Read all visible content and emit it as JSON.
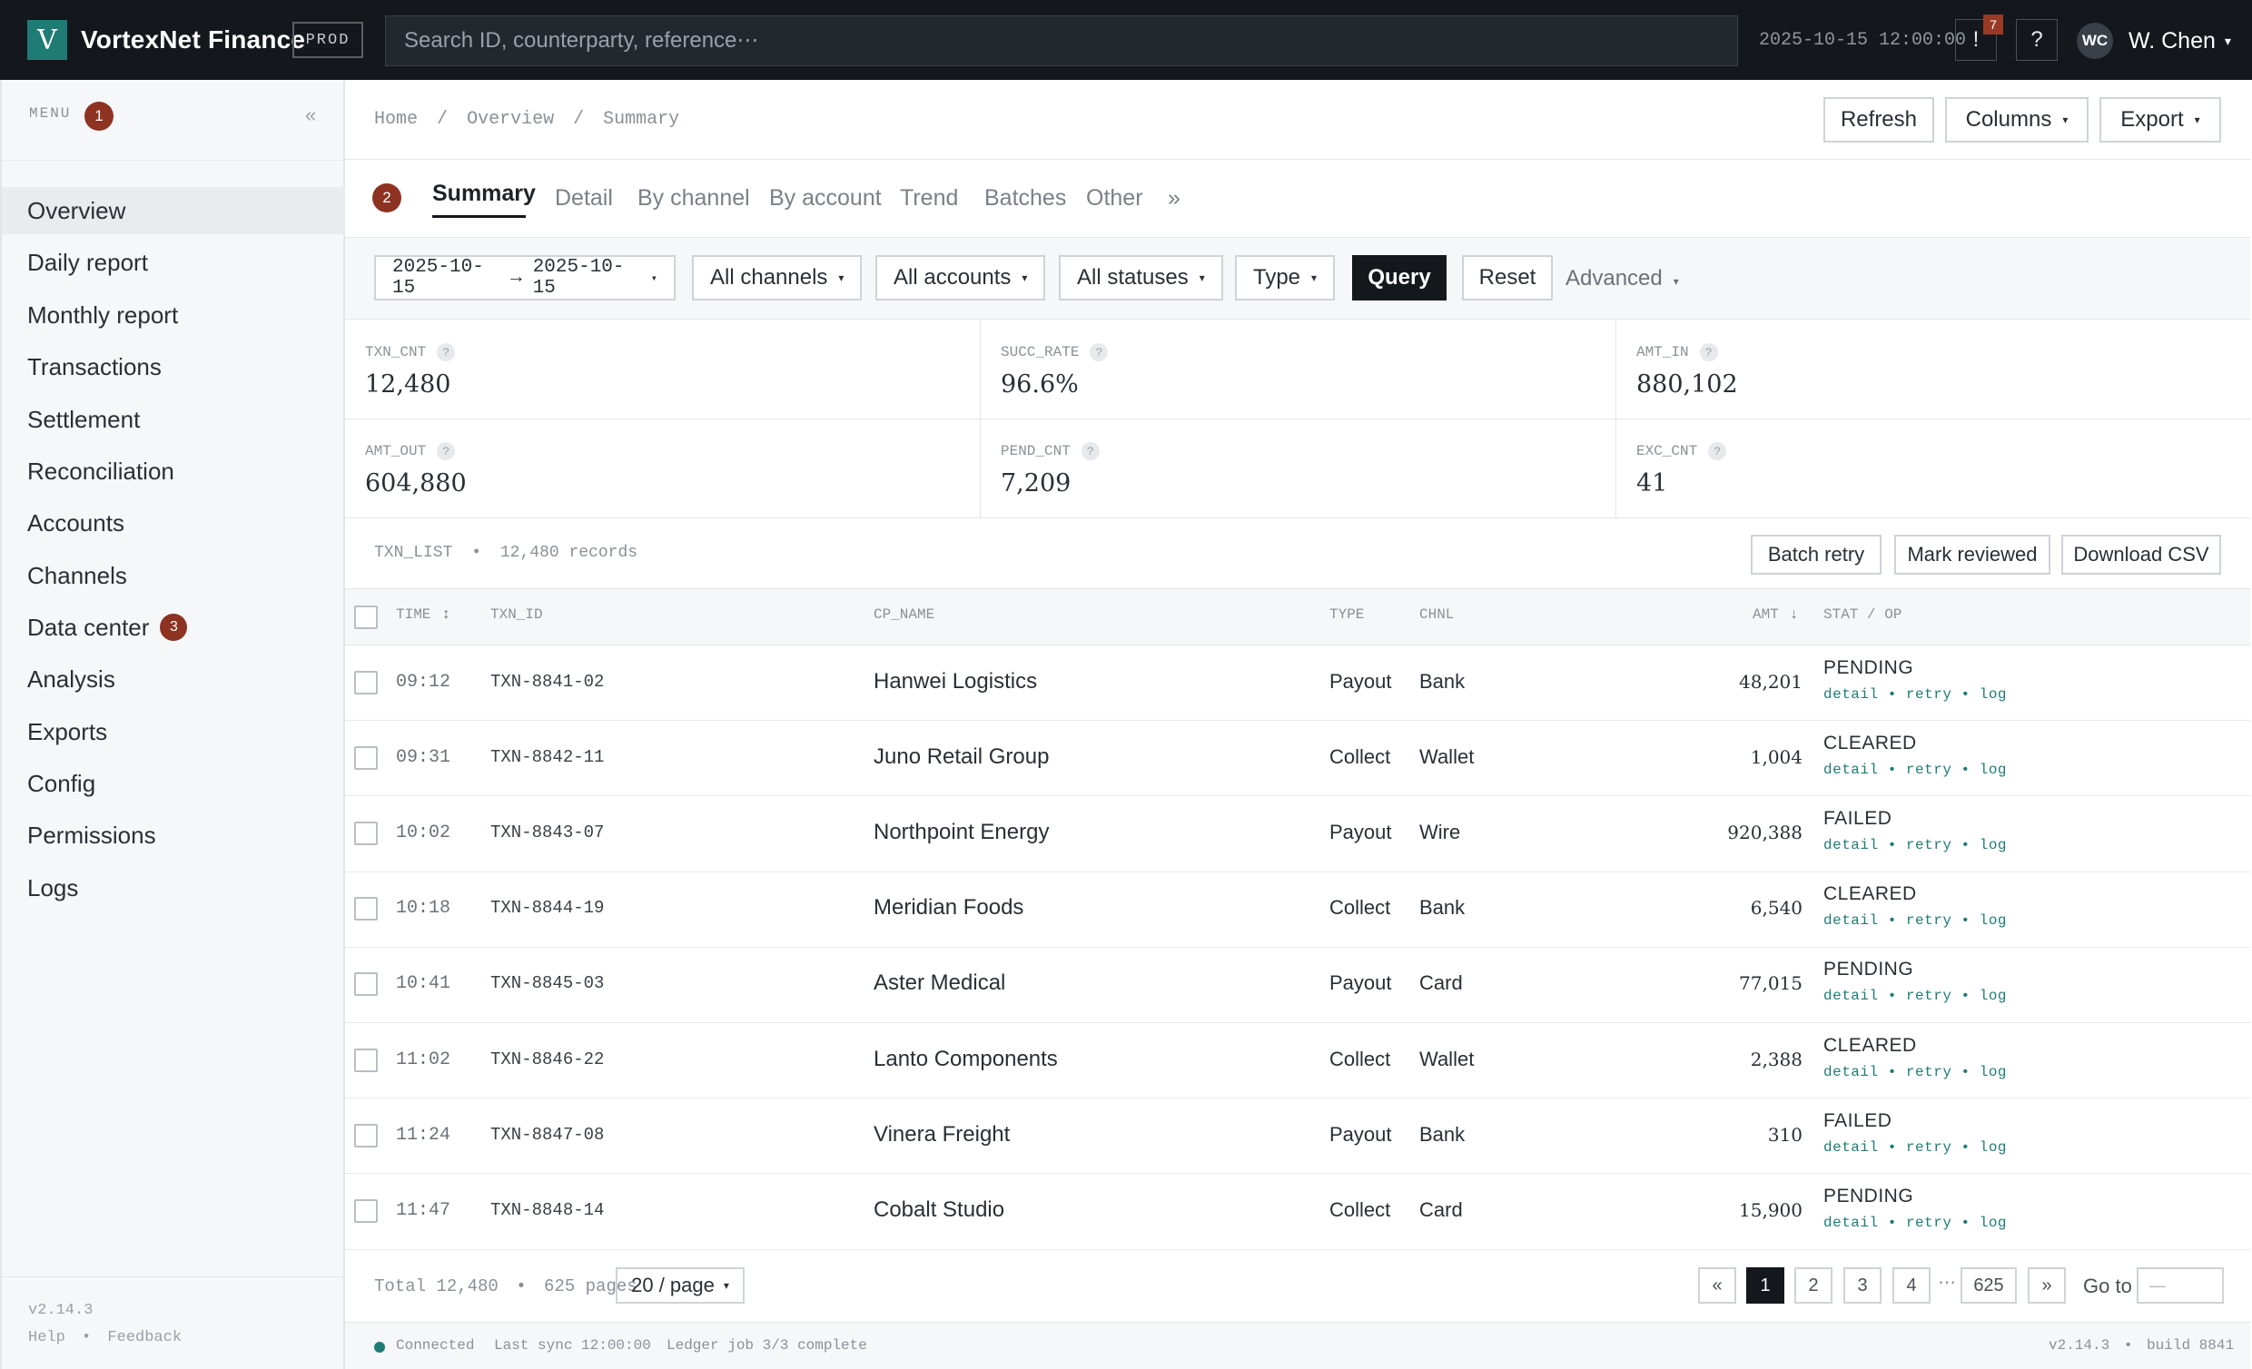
{
  "topbar": {
    "logo_letter": "V",
    "brand": "VortexNet Finance",
    "env": "PROD",
    "search_placeholder": "Search ID, counterparty, reference⋯",
    "datetime": "2025-10-15 12:00:00",
    "alert_label": "!",
    "alert_count": "7",
    "help_label": "?",
    "avatar_initials": "WC",
    "user_name": "W. Chen",
    "caret": "▾"
  },
  "sidebar": {
    "menu_label": "MENU",
    "menu_badge": "1",
    "collapse": "«",
    "items": [
      {
        "label": "Overview"
      },
      {
        "label": "Daily report"
      },
      {
        "label": "Monthly report"
      },
      {
        "label": "Transactions"
      },
      {
        "label": "Settlement"
      },
      {
        "label": "Reconciliation"
      },
      {
        "label": "Accounts"
      },
      {
        "label": "Channels"
      },
      {
        "label": "Data center",
        "badge": "3"
      },
      {
        "label": "Analysis"
      },
      {
        "label": "Exports"
      },
      {
        "label": "Config"
      },
      {
        "label": "Permissions"
      },
      {
        "label": "Logs"
      }
    ],
    "version": "v2.14.3",
    "help": "Help",
    "bullet": "•",
    "feedback": "Feedback"
  },
  "header": {
    "breadcrumb": [
      "Home",
      "Overview",
      "Summary"
    ],
    "breadcrumb_sep": "/",
    "refresh": "Refresh",
    "columns": "Columns",
    "export": "Export"
  },
  "tabs": {
    "badge": "2",
    "items": [
      "Summary",
      "Detail",
      "By channel",
      "By account",
      "Trend",
      "Batches",
      "Other"
    ],
    "more": "»"
  },
  "filters": {
    "date_from": "2025-10-15",
    "arrow": "→",
    "date_to": "2025-10-15",
    "channels": "All channels",
    "accounts": "All accounts",
    "statuses": "All statuses",
    "type": "Type",
    "query": "Query",
    "reset": "Reset",
    "advanced": "Advanced"
  },
  "stats": [
    {
      "label": "TXN_CNT",
      "value": "12,480"
    },
    {
      "label": "SUCC_RATE",
      "value": "96.6%"
    },
    {
      "label": "AMT_IN",
      "value": "880,102"
    },
    {
      "label": "AMT_OUT",
      "value": "604,880"
    },
    {
      "label": "PEND_CNT",
      "value": "7,209"
    },
    {
      "label": "EXC_CNT",
      "value": "41"
    }
  ],
  "stat_help": "?",
  "list": {
    "title": "TXN_LIST",
    "bullet": "•",
    "count": "12,480 records",
    "batch_retry": "Batch retry",
    "mark_reviewed": "Mark reviewed",
    "download_csv": "Download CSV"
  },
  "table": {
    "headers": {
      "time": "TIME",
      "time_sort": "↕",
      "txn_id": "TXN_ID",
      "cp_name": "CP_NAME",
      "type": "TYPE",
      "chnl": "CHNL",
      "amt": "AMT",
      "amt_sort": "↓",
      "stat": "STAT / OP"
    },
    "ops": "detail • retry • log",
    "rows": [
      {
        "time": "09:12",
        "id": "TXN-8841-02",
        "cp": "Hanwei Logistics",
        "type": "Payout",
        "chnl": "Bank",
        "amt": "48,201",
        "status": "PENDING"
      },
      {
        "time": "09:31",
        "id": "TXN-8842-11",
        "cp": "Juno Retail Group",
        "type": "Collect",
        "chnl": "Wallet",
        "amt": "1,004",
        "status": "CLEARED"
      },
      {
        "time": "10:02",
        "id": "TXN-8843-07",
        "cp": "Northpoint Energy",
        "type": "Payout",
        "chnl": "Wire",
        "amt": "920,388",
        "status": "FAILED"
      },
      {
        "time": "10:18",
        "id": "TXN-8844-19",
        "cp": "Meridian Foods",
        "type": "Collect",
        "chnl": "Bank",
        "amt": "6,540",
        "status": "CLEARED"
      },
      {
        "time": "10:41",
        "id": "TXN-8845-03",
        "cp": "Aster Medical",
        "type": "Payout",
        "chnl": "Card",
        "amt": "77,015",
        "status": "PENDING"
      },
      {
        "time": "11:02",
        "id": "TXN-8846-22",
        "cp": "Lanto Components",
        "type": "Collect",
        "chnl": "Wallet",
        "amt": "2,388",
        "status": "CLEARED"
      },
      {
        "time": "11:24",
        "id": "TXN-8847-08",
        "cp": "Vinera Freight",
        "type": "Payout",
        "chnl": "Bank",
        "amt": "310",
        "status": "FAILED"
      },
      {
        "time": "11:47",
        "id": "TXN-8848-14",
        "cp": "Cobalt Studio",
        "type": "Collect",
        "chnl": "Card",
        "amt": "15,900",
        "status": "PENDING"
      }
    ]
  },
  "pagination": {
    "total_text": "Total 12,480",
    "bullet": "•",
    "pages_text": "625 pages",
    "page_size": "20 / page",
    "prev": "«",
    "pages": [
      "1",
      "2",
      "3",
      "4"
    ],
    "ellipsis": "⋯",
    "last": "625",
    "next": "»",
    "goto_label": "Go to",
    "goto_placeholder": "—"
  },
  "statusbar": {
    "connected": "Connected",
    "sync": "Last sync 12:00:00",
    "job": "Ledger job 3/3 complete",
    "version": "v2.14.3",
    "bullet": "•",
    "build": "build 8841"
  },
  "colors": {
    "topbar": "#14181d",
    "accent": "#1f7c74",
    "badge": "#8e3222"
  }
}
